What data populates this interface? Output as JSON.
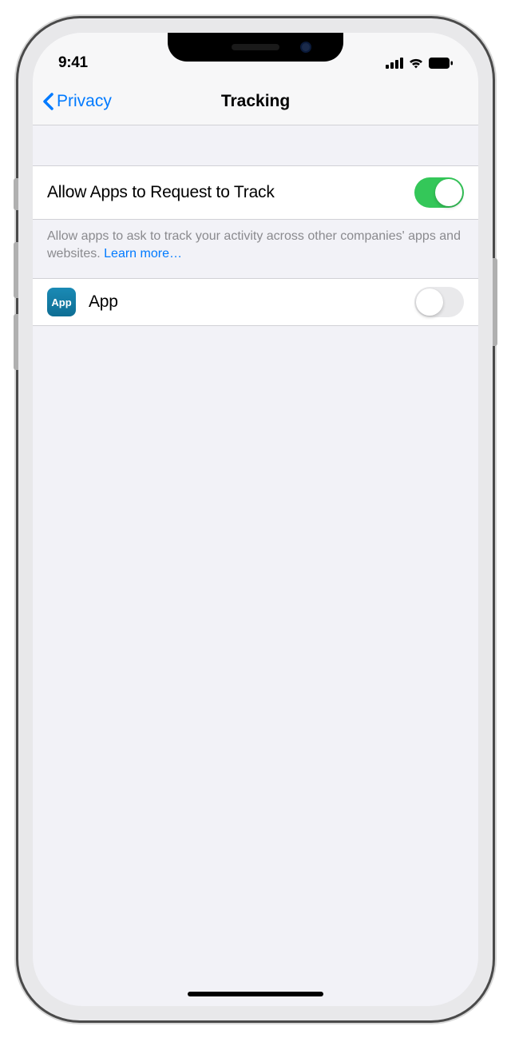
{
  "status": {
    "time": "9:41"
  },
  "nav": {
    "back_label": "Privacy",
    "title": "Tracking"
  },
  "main_toggle": {
    "label": "Allow Apps to Request to Track",
    "on": true
  },
  "footer": {
    "text": "Allow apps to ask to track your activity across other companies' apps and websites. ",
    "link": "Learn more…"
  },
  "apps": [
    {
      "icon_text": "App",
      "name": "App",
      "on": false
    }
  ]
}
